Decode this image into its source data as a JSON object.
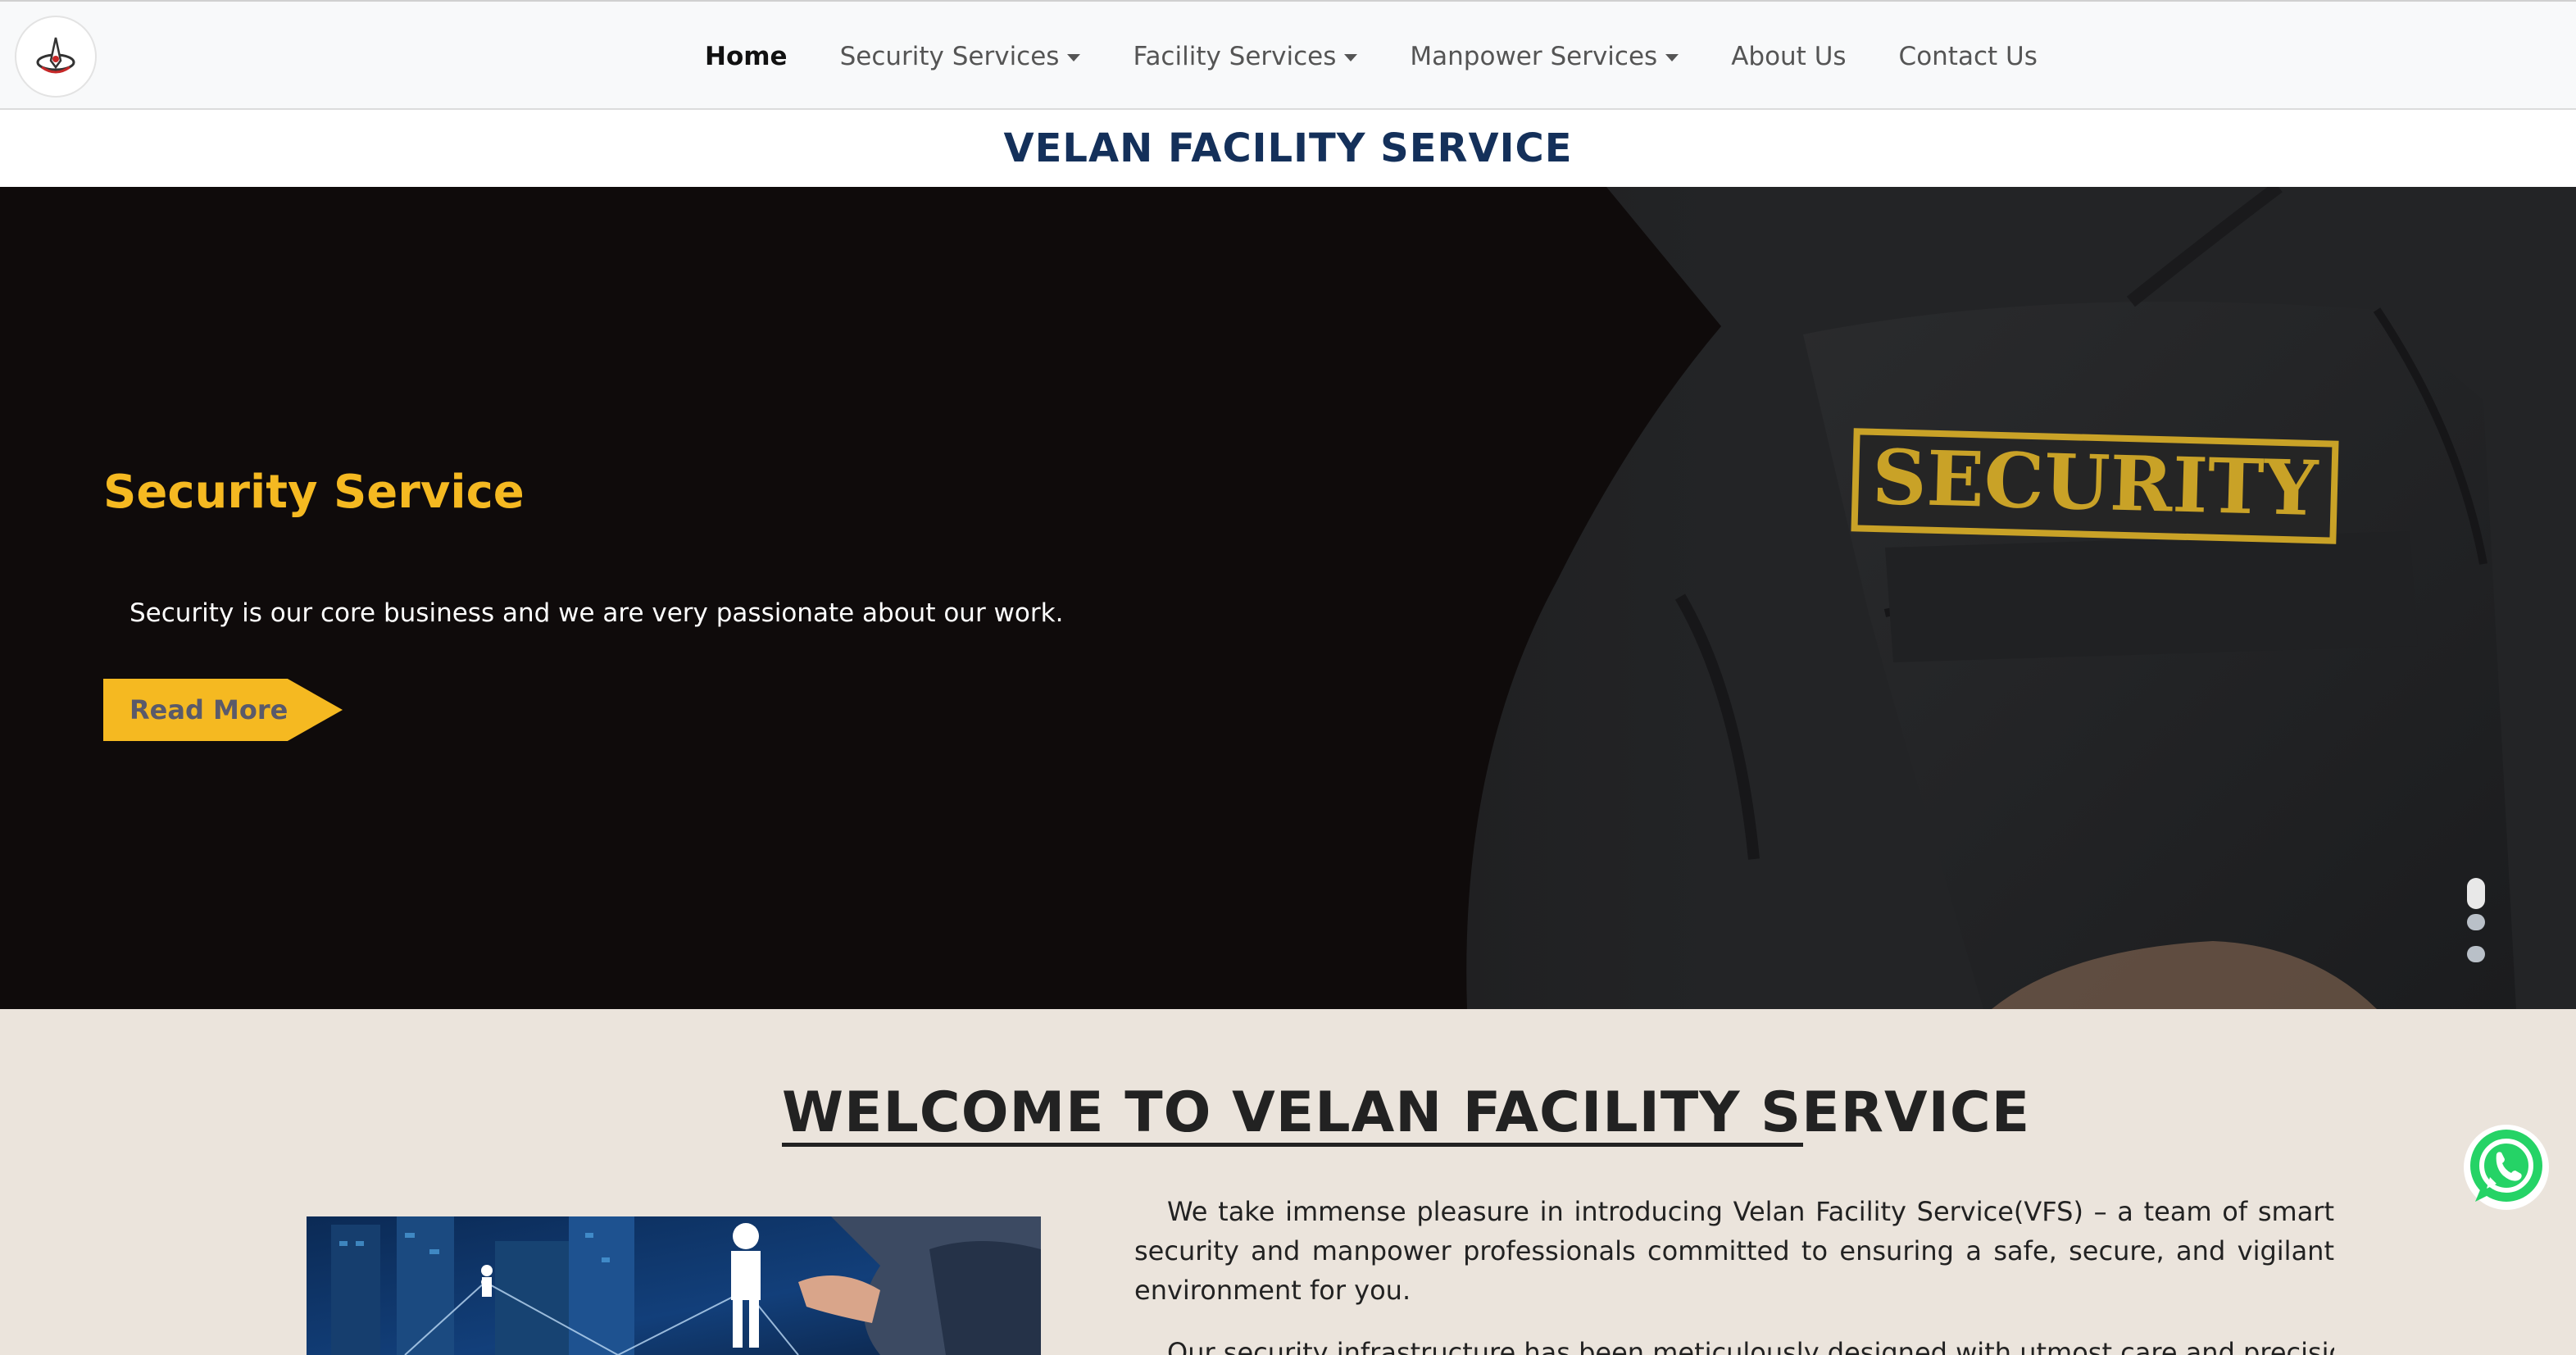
{
  "nav": {
    "logo_alt": "Velan Facility Service logo",
    "items": [
      {
        "label": "Home",
        "active": true,
        "dropdown": false
      },
      {
        "label": "Security Services",
        "active": false,
        "dropdown": true
      },
      {
        "label": "Facility Services",
        "active": false,
        "dropdown": true
      },
      {
        "label": "Manpower Services",
        "active": false,
        "dropdown": true
      },
      {
        "label": "About Us",
        "active": false,
        "dropdown": false
      },
      {
        "label": "Contact Us",
        "active": false,
        "dropdown": false
      }
    ]
  },
  "site_title": "VELAN FACILITY SERVICE",
  "hero": {
    "title": "Security Service",
    "text": "Security is our core business and we are very passionate about our work.",
    "button_label": "Read More",
    "patch_text": "SECURITY",
    "slides_total": 3,
    "active_slide": 1
  },
  "welcome": {
    "title": "WELCOME TO VELAN FACILITY SERVICE",
    "paragraph1": "We take immense pleasure in introducing Velan Facility Service(VFS) – a team of smart security and manpower professionals committed to ensuring a safe, secure, and vigilant environment for you.",
    "paragraph2": "Our security infrastructure has been meticulously designed with utmost care and precision under"
  },
  "colors": {
    "accent": "#f5b921",
    "title_navy": "#14305a",
    "hero_bg": "#0f0b0b",
    "page_bg": "#ebe4dc",
    "whatsapp": "#25d366"
  },
  "icons": {
    "logo": "compass-logo-icon",
    "whatsapp": "whatsapp-icon",
    "dropdown": "caret-down-icon"
  }
}
